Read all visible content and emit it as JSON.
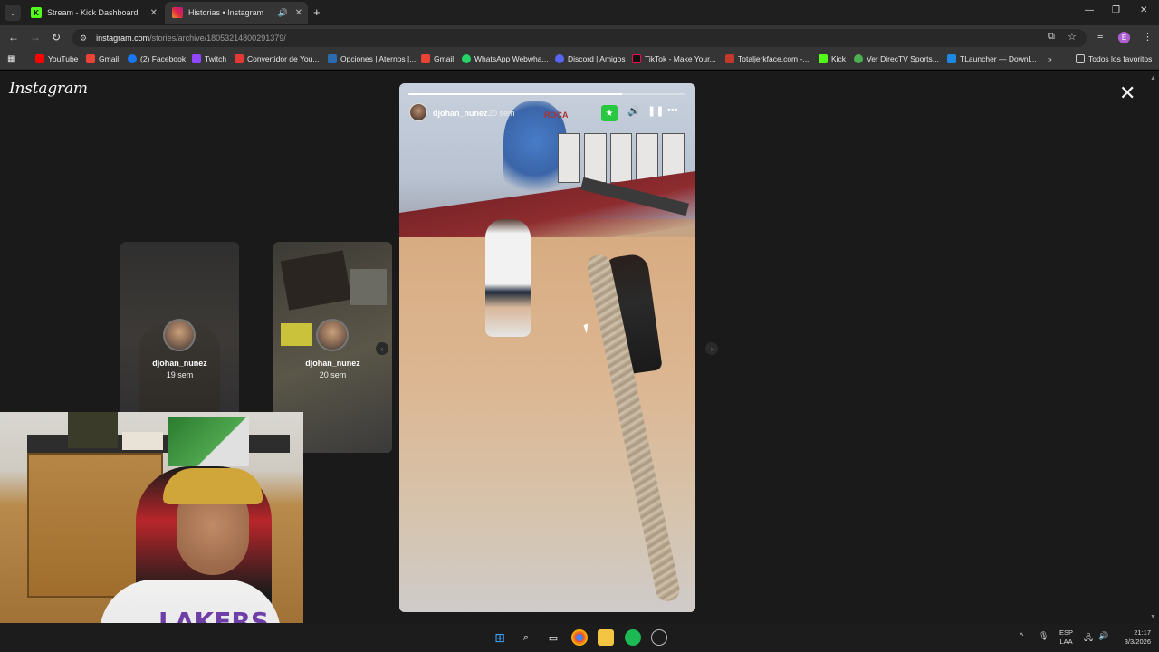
{
  "tabs": [
    {
      "title": "Stream - Kick Dashboard",
      "favicon": "kick-icon",
      "color": "#53fc18"
    },
    {
      "title": "Historias • Instagram",
      "favicon": "instagram-icon",
      "color": "#e1306c",
      "audio": true
    }
  ],
  "address_bar": {
    "host": "instagram.com",
    "path": "/stories/archive/18053214800291379/"
  },
  "bookmarks": [
    {
      "label": "YouTube",
      "icon": "youtube-icon",
      "color": "#ff0000"
    },
    {
      "label": "Gmail",
      "icon": "gmail-icon",
      "color": "#ea4335"
    },
    {
      "label": "(2) Facebook",
      "icon": "facebook-icon",
      "color": "#1877f2"
    },
    {
      "label": "Twitch",
      "icon": "twitch-icon",
      "color": "#9146ff"
    },
    {
      "label": "Convertidor de You...",
      "icon": "converter-icon",
      "color": "#e53935"
    },
    {
      "label": "Opciones | Aternos |...",
      "icon": "aternos-icon",
      "color": "#2b6cb0"
    },
    {
      "label": "Gmail",
      "icon": "gmail-icon",
      "color": "#ea4335"
    },
    {
      "label": "WhatsApp Webwha...",
      "icon": "whatsapp-icon",
      "color": "#25d366"
    },
    {
      "label": "Discord | Amigos",
      "icon": "discord-icon",
      "color": "#5865f2"
    },
    {
      "label": "TikTok - Make Your...",
      "icon": "tiktok-icon",
      "color": "#111111"
    },
    {
      "label": "Totaljerkface.com -...",
      "icon": "totaljerkface-icon",
      "color": "#c0392b"
    },
    {
      "label": "Kick",
      "icon": "kick-icon",
      "color": "#53fc18"
    },
    {
      "label": "Ver DirecTV Sports...",
      "icon": "directv-icon",
      "color": "#4caf50"
    },
    {
      "label": "TLauncher — Downl...",
      "icon": "tlauncher-icon",
      "color": "#1e88e5"
    }
  ],
  "bookmarks_all": "Todos los favoritos",
  "instagram": {
    "logo": "Instagram",
    "previous_stories": [
      {
        "user": "djohan_nunez",
        "time": "19 sem"
      },
      {
        "user": "djohan_nunez",
        "time": "20 sem"
      }
    ],
    "story": {
      "user": "djohan_nunez",
      "time": "20 sem",
      "progress": 0.77,
      "mural_text": "ROCA"
    }
  },
  "webcam": {
    "shirt_text": "LAKERS"
  },
  "taskbar": {
    "language": "ESP",
    "layout": "LAA",
    "time": "21:17",
    "date": "3/3/2026"
  }
}
